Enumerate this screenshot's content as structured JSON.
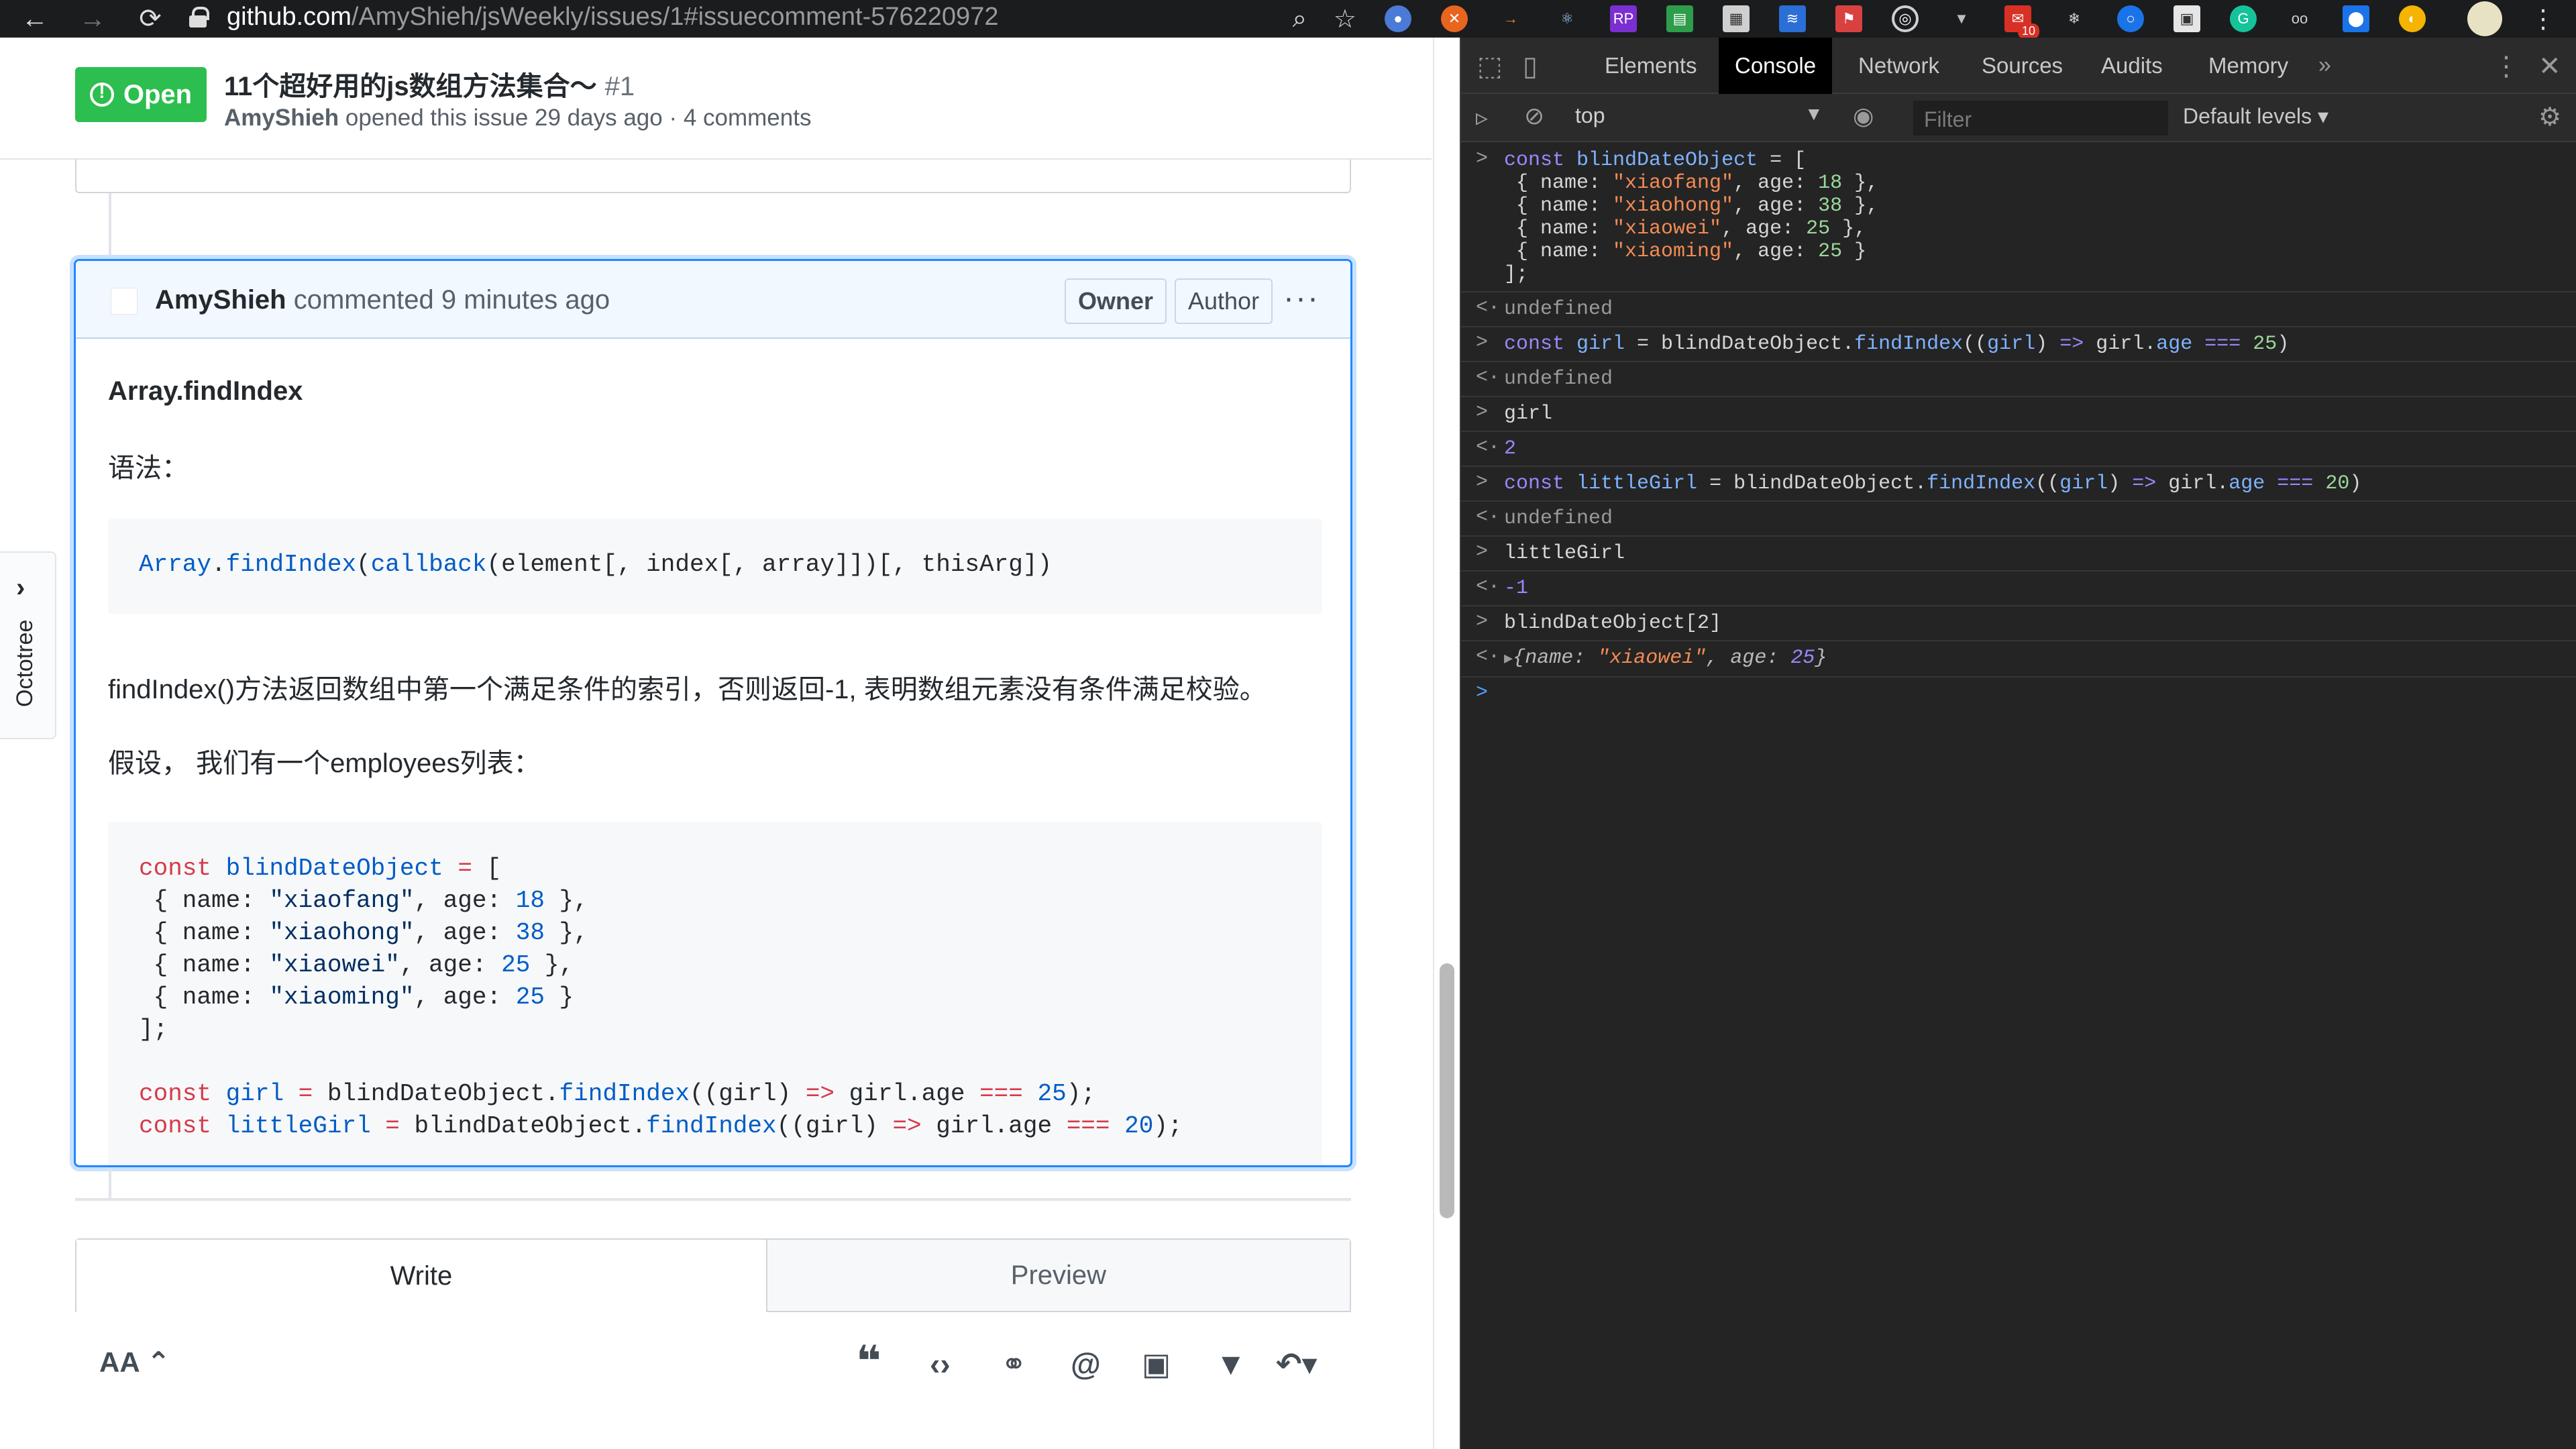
{
  "browser": {
    "url_host": "github.com",
    "url_path": "/AmyShieh/jsWeekly/issues/1#issuecomment-576220972",
    "extensions_badge": "10"
  },
  "issue": {
    "state": "Open",
    "title": "11个超好用的js数组方法集合～",
    "number": "#1",
    "author": "AmyShieh",
    "meta": "opened this issue 29 days ago · 4 comments"
  },
  "comment": {
    "author": "AmyShieh",
    "time": "commented 9 minutes ago",
    "owner_label": "Owner",
    "author_label": "Author",
    "more": "···",
    "heading": "Array.findIndex",
    "syntax_label": "语法：",
    "syntax_code": {
      "obj": "Array",
      "method": "findIndex",
      "cb": "callback",
      "args": "(element[, index[, array]])[, thisArg])"
    },
    "description": "findIndex()方法返回数组中第一个满足条件的索引，否则返回-1, 表明数组元素没有条件满足校验。",
    "assume": "假设， 我们有一个employees列表："
  },
  "composer": {
    "write_tab": "Write",
    "preview_tab": "Preview",
    "text_size": "AA"
  },
  "octotree": {
    "label": "Octotree"
  },
  "devtools": {
    "tabs": [
      "Elements",
      "Console",
      "Network",
      "Sources",
      "Audits",
      "Memory"
    ],
    "active_tab": "Console",
    "context": "top",
    "filter_placeholder": "Filter",
    "levels": "Default levels ▾"
  },
  "console_lines": {
    "undefined1": "undefined",
    "undefined2": "undefined",
    "girl_input": "girl",
    "girl_result": "2",
    "undefined3": "undefined",
    "littlegirl_input": "littleGirl",
    "littlegirl_result": "-1",
    "index_input": "blindDateObject[2]"
  }
}
